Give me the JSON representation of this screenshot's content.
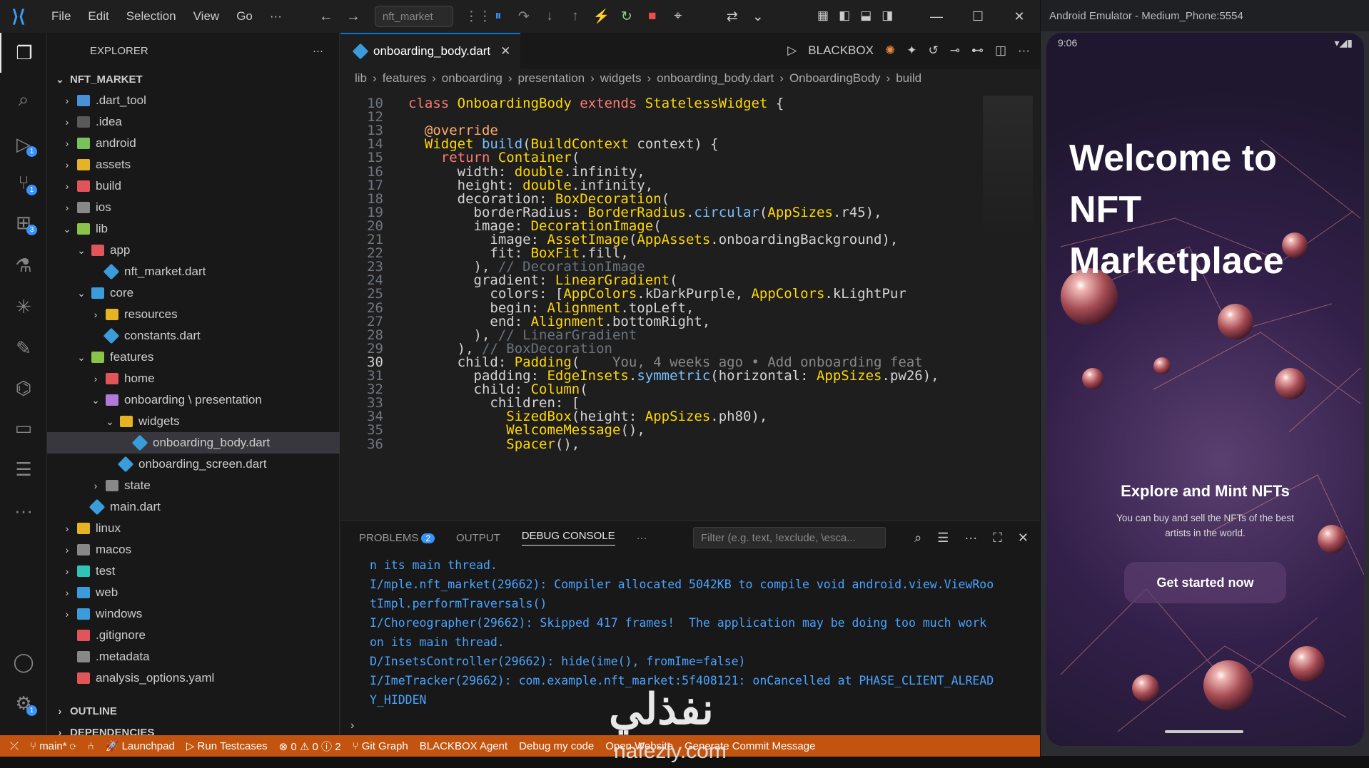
{
  "window": {
    "menu": [
      "File",
      "Edit",
      "Selection",
      "View",
      "Go",
      "···"
    ],
    "command_center": "nft_market"
  },
  "activity_badges": {
    "debug": "1",
    "scm": "1",
    "extensions": "3",
    "accounts": "1"
  },
  "explorer": {
    "title": "EXPLORER",
    "root": "NFT_MARKET",
    "items": [
      {
        "label": ".dart_tool",
        "depth": 1,
        "chev": "›",
        "icon": "#4a90d9"
      },
      {
        "label": ".idea",
        "depth": 1,
        "chev": "›",
        "icon": "#5a5a5a"
      },
      {
        "label": "android",
        "depth": 1,
        "chev": "›",
        "icon": "#78c257"
      },
      {
        "label": "assets",
        "depth": 1,
        "chev": "›",
        "icon": "#e6b422"
      },
      {
        "label": "build",
        "depth": 1,
        "chev": "›",
        "icon": "#e0555a"
      },
      {
        "label": "ios",
        "depth": 1,
        "chev": "›",
        "icon": "#888"
      },
      {
        "label": "lib",
        "depth": 1,
        "chev": "⌄",
        "icon": "#8bc34a"
      },
      {
        "label": "app",
        "depth": 2,
        "chev": "⌄",
        "icon": "#e0555a"
      },
      {
        "label": "nft_market.dart",
        "depth": 3,
        "chev": "",
        "icon": "dart"
      },
      {
        "label": "core",
        "depth": 2,
        "chev": "⌄",
        "icon": "#3b9cdb"
      },
      {
        "label": "resources",
        "depth": 3,
        "chev": "›",
        "icon": "#e6b422"
      },
      {
        "label": "constants.dart",
        "depth": 3,
        "chev": "",
        "icon": "dart"
      },
      {
        "label": "features",
        "depth": 2,
        "chev": "⌄",
        "icon": "#8bc34a"
      },
      {
        "label": "home",
        "depth": 3,
        "chev": "›",
        "icon": "#e0555a"
      },
      {
        "label": "onboarding \\ presentation",
        "depth": 3,
        "chev": "⌄",
        "icon": "#b07ad8"
      },
      {
        "label": "widgets",
        "depth": 4,
        "chev": "⌄",
        "icon": "#e6b422"
      },
      {
        "label": "onboarding_body.dart",
        "depth": 5,
        "chev": "",
        "icon": "dart",
        "selected": true
      },
      {
        "label": "onboarding_screen.dart",
        "depth": 4,
        "chev": "",
        "icon": "dart"
      },
      {
        "label": "state",
        "depth": 3,
        "chev": "›",
        "icon": "#888"
      },
      {
        "label": "main.dart",
        "depth": 2,
        "chev": "",
        "icon": "dart"
      },
      {
        "label": "linux",
        "depth": 1,
        "chev": "›",
        "icon": "#e6b422"
      },
      {
        "label": "macos",
        "depth": 1,
        "chev": "›",
        "icon": "#888"
      },
      {
        "label": "test",
        "depth": 1,
        "chev": "›",
        "icon": "#2ec4b6"
      },
      {
        "label": "web",
        "depth": 1,
        "chev": "›",
        "icon": "#3b9cdb"
      },
      {
        "label": "windows",
        "depth": 1,
        "chev": "›",
        "icon": "#3b9cdb"
      },
      {
        "label": ".gitignore",
        "depth": 1,
        "chev": "",
        "icon": "#e0555a"
      },
      {
        "label": ".metadata",
        "depth": 1,
        "chev": "",
        "icon": "#888"
      },
      {
        "label": "analysis_options.yaml",
        "depth": 1,
        "chev": "",
        "icon": "#e0555a"
      }
    ],
    "outline": "OUTLINE",
    "dependencies": "DEPENDENCIES"
  },
  "editor": {
    "tab": "onboarding_body.dart",
    "blackbox": "BLACKBOX",
    "breadcrumbs": [
      "lib",
      "features",
      "onboarding",
      "presentation",
      "widgets",
      "onboarding_body.dart",
      "OnboardingBody",
      "build"
    ],
    "current_line": 30,
    "lines": [
      {
        "n": "10",
        "html": "<span class='k'>class</span> <span class='ty'>OnboardingBody</span> <span class='k'>extends</span> <span class='ty'>StatelessWidget</span> {"
      },
      {
        "n": "12",
        "html": ""
      },
      {
        "n": "13",
        "html": "  <span class='an'>@override</span>"
      },
      {
        "n": "14",
        "html": "  <span class='ty'>Widget</span> <span class='fn'>build</span>(<span class='ty'>BuildContext</span> context) {"
      },
      {
        "n": "15",
        "html": "    <span class='k'>return</span> <span class='ty'>Container</span>("
      },
      {
        "n": "16",
        "html": "      width: <span class='ty'>double</span>.infinity,"
      },
      {
        "n": "17",
        "html": "      height: <span class='ty'>double</span>.infinity,"
      },
      {
        "n": "18",
        "html": "      decoration: <span class='ty'>BoxDecoration</span>("
      },
      {
        "n": "19",
        "html": "        borderRadius: <span class='ty'>BorderRadius</span>.<span class='fn'>circular</span>(<span class='ty'>AppSizes</span>.r45),"
      },
      {
        "n": "20",
        "html": "        image: <span class='ty'>DecorationImage</span>("
      },
      {
        "n": "21",
        "html": "          image: <span class='ty'>AssetImage</span>(<span class='ty'>AppAssets</span>.onboardingBackground),"
      },
      {
        "n": "22",
        "html": "          fit: <span class='ty'>BoxFit</span>.fill,"
      },
      {
        "n": "23",
        "html": "        ), <span class='cm'>// DecorationImage</span>"
      },
      {
        "n": "24",
        "html": "        gradient: <span class='ty'>LinearGradient</span>("
      },
      {
        "n": "25",
        "html": "          colors: [<span class='ty'>AppColors</span>.kDarkPurple, <span class='ty'>AppColors</span>.kLightPur"
      },
      {
        "n": "26",
        "html": "          begin: <span class='ty'>Alignment</span>.topLeft,"
      },
      {
        "n": "27",
        "html": "          end: <span class='ty'>Alignment</span>.bottomRight,"
      },
      {
        "n": "28",
        "html": "        ), <span class='cm'>// LinearGradient</span>"
      },
      {
        "n": "29",
        "html": "      ), <span class='cm'>// BoxDecoration</span>"
      },
      {
        "n": "30",
        "html": "      child: <span class='ty'>Padding</span>(    <span class='gl'>You, 4 weeks ago • Add onboarding feat</span>"
      },
      {
        "n": "31",
        "html": "        padding: <span class='ty'>EdgeInsets</span>.<span class='fn'>symmetric</span>(horizontal: <span class='ty'>AppSizes</span>.pw26),"
      },
      {
        "n": "32",
        "html": "        child: <span class='ty'>Column</span>("
      },
      {
        "n": "33",
        "html": "          children: ["
      },
      {
        "n": "34",
        "html": "            <span class='ty'>SizedBox</span>(height: <span class='ty'>AppSizes</span>.ph80),"
      },
      {
        "n": "35",
        "html": "            <span class='ty'>WelcomeMessage</span>(),"
      },
      {
        "n": "36",
        "html": "            <span class='ty'>Spacer</span>(),"
      }
    ]
  },
  "panel": {
    "problems": "PROBLEMS",
    "problems_count": "2",
    "output": "OUTPUT",
    "debug_console": "DEBUG CONSOLE",
    "filter_placeholder": "Filter (e.g. text, !exclude, \\esca...",
    "log": "n its main thread.\nI/mple.nft_market(29662): Compiler allocated 5042KB to compile void android.view.ViewRoo\ntImpl.performTraversals()\nI/Choreographer(29662): Skipped 417 frames!  The application may be doing too much work\non its main thread.\nD/InsetsController(29662): hide(ime(), fromIme=false)\nI/ImeTracker(29662): com.example.nft_market:5f408121: onCancelled at PHASE_CLIENT_ALREAD\nY_HIDDEN"
  },
  "statusbar": {
    "branch": "main*",
    "launchpad": "Launchpad",
    "run_testcases": "Run Testcases",
    "problems": "⊗ 0 ⚠ 0 ⓘ 2",
    "git_graph": "Git Graph",
    "blackbox_agent": "BLACKBOX Agent",
    "debug_code": "Debug my code",
    "open_website": "Open Website",
    "commit_msg": "Generate Commit Message"
  },
  "emulator": {
    "title": "Android Emulator - Medium_Phone:5554",
    "time": "9:06",
    "welcome": "Welcome to NFT Marketplace",
    "explore": "Explore and Mint NFTs",
    "subtitle": "You can buy and sell the NFTs of the best artists in the world.",
    "cta": "Get started now"
  },
  "watermark": {
    "arabic": "نفذلي",
    "latin": "nafezly.com"
  },
  "colors": {
    "accent": "#0078d4",
    "statusbar": "#c25410",
    "keyword": "#ff7b72",
    "type": "#ffd700"
  }
}
